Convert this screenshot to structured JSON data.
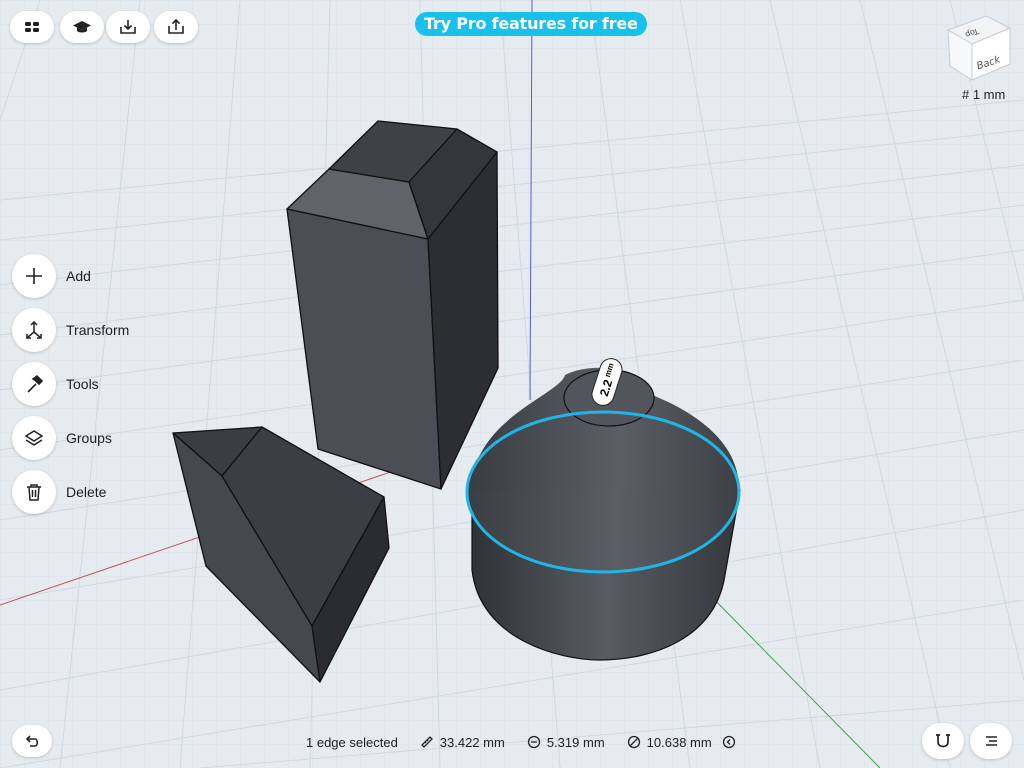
{
  "banner": {
    "label": "Try Pro features for free"
  },
  "toolbar": {
    "icons": [
      "grid-menu-icon",
      "graduation-cap-icon",
      "import-icon",
      "share-icon"
    ]
  },
  "view_cube": {
    "face_label": "Back",
    "top_label": "Top"
  },
  "grid_scale": {
    "label": "# 1 mm"
  },
  "side_menu": {
    "items": [
      {
        "label": "Add",
        "icon": "plus-icon"
      },
      {
        "label": "Transform",
        "icon": "transform-icon"
      },
      {
        "label": "Tools",
        "icon": "hammer-icon"
      },
      {
        "label": "Groups",
        "icon": "layers-icon"
      },
      {
        "label": "Delete",
        "icon": "trash-icon"
      }
    ]
  },
  "dimension_tag": {
    "value": "2.2",
    "unit": "mm"
  },
  "status": {
    "selection": "1 edge selected",
    "length": "33.422 mm",
    "radius": "5.319 mm",
    "diameter": "10.638 mm"
  },
  "colors": {
    "accent": "#18c0ee",
    "selection": "#1fb6e6",
    "solid": "#4a4d52",
    "grid_bg": "#e6ebf0"
  }
}
